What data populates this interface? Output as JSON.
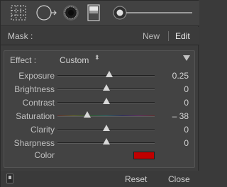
{
  "toolstrip": {
    "tools": [
      {
        "icon": "crop-overlay-icon"
      },
      {
        "icon": "spot-removal-icon"
      },
      {
        "icon": "red-eye-icon"
      },
      {
        "icon": "graduated-filter-icon"
      },
      {
        "icon": "adjustment-brush-icon"
      }
    ]
  },
  "mask": {
    "label": "Mask :",
    "new_label": "New",
    "edit_label": "Edit"
  },
  "effect": {
    "label": "Effect :",
    "preset": "Custom",
    "preset_arrows": "⬍"
  },
  "sliders": [
    {
      "name": "exposure",
      "label": "Exposure",
      "value": "0.25",
      "position": 0.53
    },
    {
      "name": "brightness",
      "label": "Brightness",
      "value": "0",
      "position": 0.5
    },
    {
      "name": "contrast",
      "label": "Contrast",
      "value": "0",
      "position": 0.5
    },
    {
      "name": "saturation",
      "label": "Saturation",
      "value": "– 38",
      "position": 0.31
    },
    {
      "name": "clarity",
      "label": "Clarity",
      "value": "0",
      "position": 0.5
    },
    {
      "name": "sharpness",
      "label": "Sharpness",
      "value": "0",
      "position": 0.5
    }
  ],
  "color": {
    "label": "Color",
    "swatch": "#c00000"
  },
  "footer": {
    "reset_label": "Reset",
    "close_label": "Close"
  },
  "colors": {
    "panel_bg": "#3d3d3d",
    "text": "#c4c4c4",
    "thumb": "#d8d8d8"
  }
}
